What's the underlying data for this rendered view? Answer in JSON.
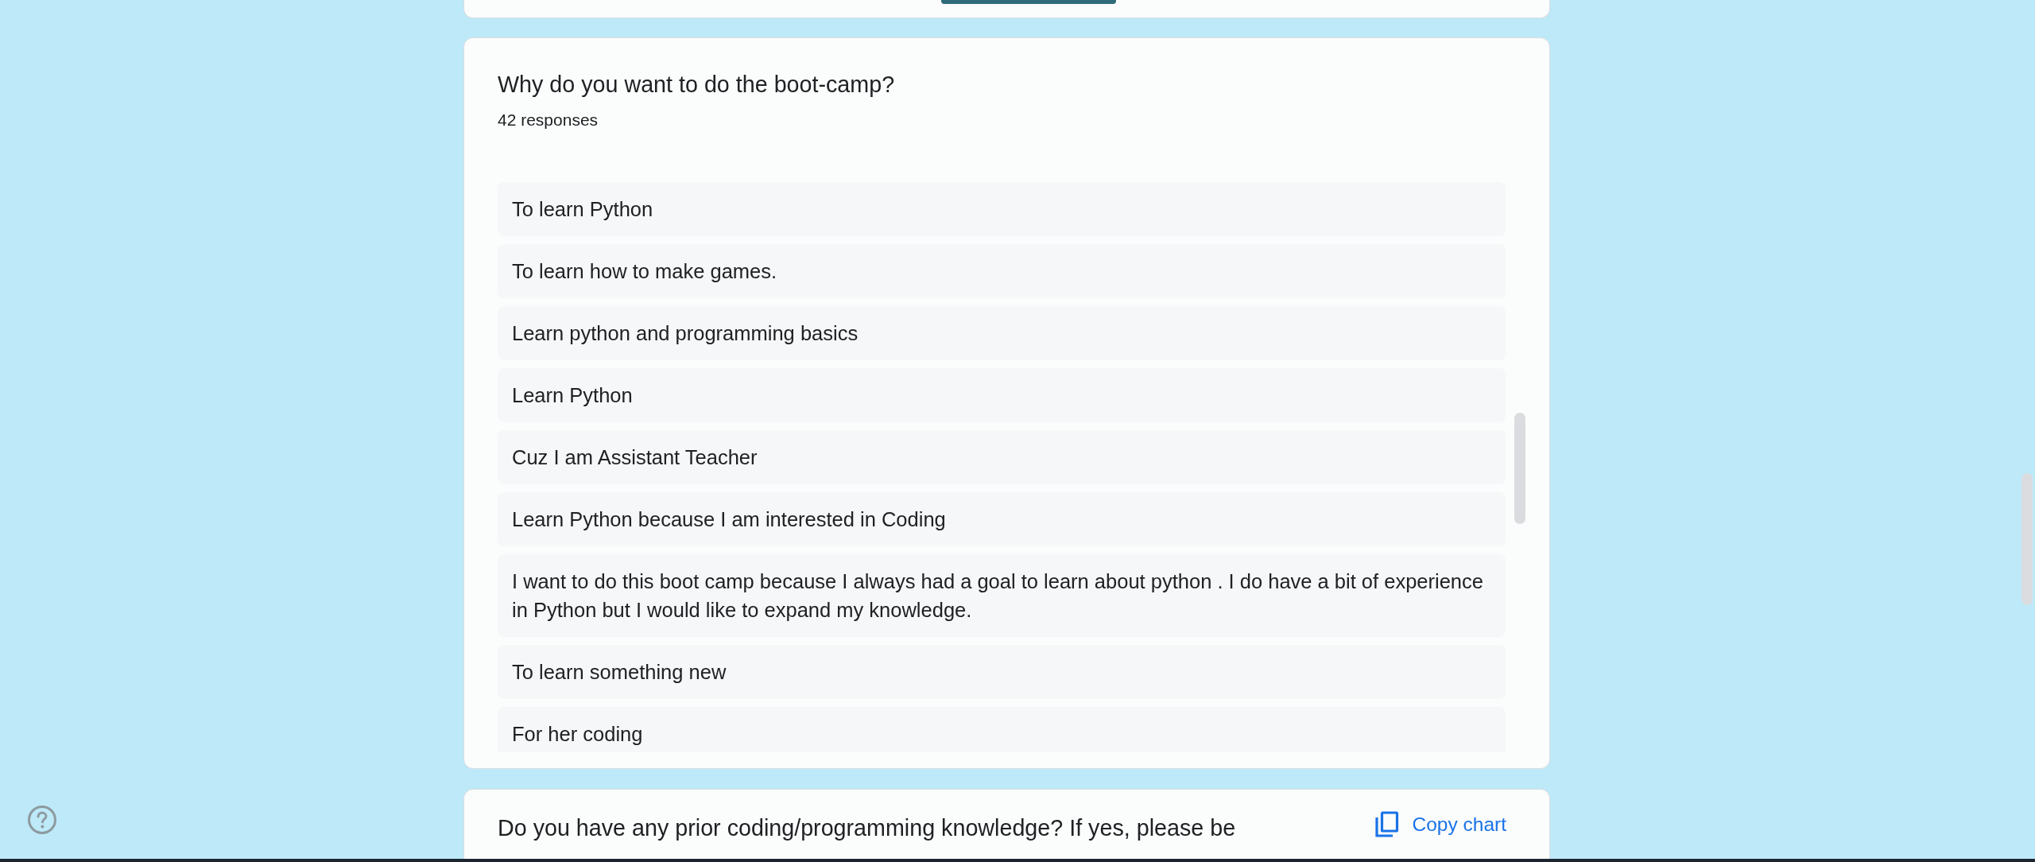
{
  "question": {
    "title": "Why do you want to do the boot-camp?",
    "responses_count": "42 responses"
  },
  "responses": [
    "To learn Python",
    "To learn how to make games.",
    "Learn python and programming basics",
    "Learn Python",
    "Cuz I am Assistant Teacher",
    "Learn Python because I am interested in Coding",
    "I want to do this boot camp because I always had a goal to learn about python . I do have a bit of experience in Python but I would like to expand my knowledge.",
    "To learn something new",
    "For her coding"
  ],
  "next_question": {
    "title": "Do you have any prior coding/programming knowledge? If yes, please be",
    "copy_button": "Copy chart"
  }
}
